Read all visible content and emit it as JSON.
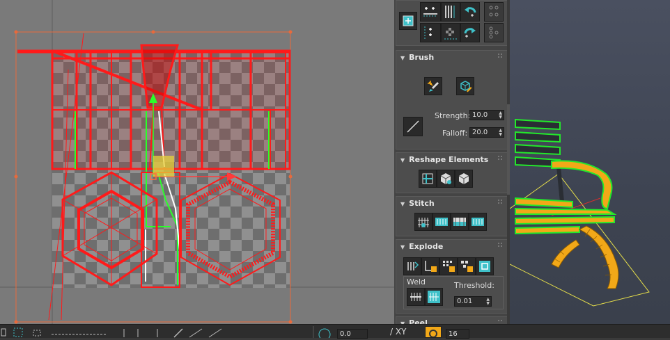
{
  "panel": {
    "brush": {
      "title": "Brush",
      "strength_label": "Strength:",
      "strength_value": "10.0",
      "falloff_label": "Falloff:",
      "falloff_value": "20.0"
    },
    "reshape": {
      "title": "Reshape Elements"
    },
    "stitch": {
      "title": "Stitch"
    },
    "explode": {
      "title": "Explode",
      "weld_label": "Weld",
      "threshold_label": "Threshold:",
      "threshold_value": "0.01"
    },
    "peel": {
      "title": "Peel"
    }
  },
  "bottom": {
    "value1": "0.0",
    "xy_label": "XY",
    "value2": "16"
  },
  "colors": {
    "selection": "#ff1a1a",
    "gizmo_box": "#e86a3c",
    "accent_teal": "#3fc1c9",
    "bench_orange": "#f2a818",
    "bench_edge": "#23e82b"
  }
}
